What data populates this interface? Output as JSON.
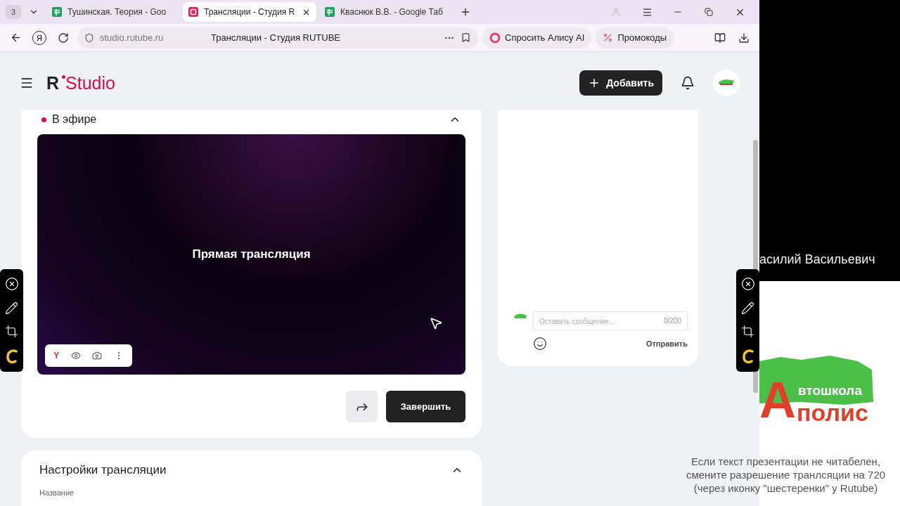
{
  "browser": {
    "tab_count": "3",
    "tabs": [
      {
        "title": "Тушинская. Теория - Goo",
        "kind": "sheets",
        "selected": false
      },
      {
        "title": "Трансляции - Студия R",
        "kind": "rutube",
        "selected": true
      },
      {
        "title": "Кваснюк В.В. - Google Таб",
        "kind": "sheets",
        "selected": false
      }
    ],
    "yandex_button": "Я",
    "url": "studio.rutube.ru",
    "page_title": "Трансляции - Студия RUTUBE",
    "alice_button": "Спросить Алису AI",
    "promo_button": "Промокоды"
  },
  "header": {
    "logo_mark": "R",
    "logo_text": "Studio",
    "add_button": "Добавить"
  },
  "live_card": {
    "status": "В эфире",
    "live": true,
    "video_title": "Прямая трансляция",
    "player_badge": "Y",
    "finish_button": "Завершить"
  },
  "settings_card": {
    "title": "Настройки трансляции",
    "field_label": "Название"
  },
  "chat": {
    "placeholder": "Оставить сообщение...",
    "counter": "0/200",
    "send_button": "Отправить"
  },
  "side_panel": {
    "speaker": "асилий Васильевич",
    "logo": {
      "big_letter": "А",
      "line1": "втошкола",
      "line2": "полис"
    },
    "note": [
      "Если текст презентации не читабелен,",
      "смените разрешение транлсяции на 720",
      "(через иконку \"шестеренки\" у Rutube)"
    ]
  }
}
